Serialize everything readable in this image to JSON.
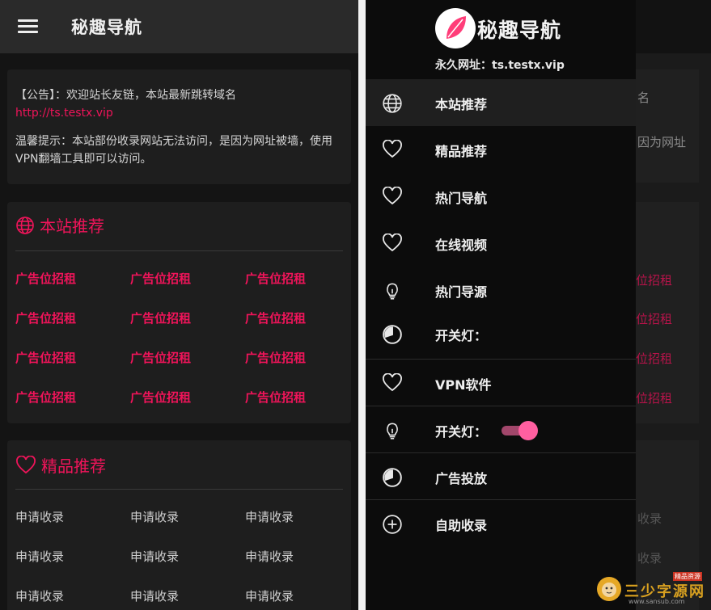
{
  "left": {
    "header": {
      "title": "秘趣导航"
    },
    "notice": {
      "line1": "【公告】：欢迎站长友链，本站最新跳转域名",
      "link": "http://ts.testx.vip",
      "tip": "温馨提示：本站部份收录网站无法访问，是因为网址被墙，使用VPN翻墙工具即可以访问。"
    },
    "section1": {
      "title": "本站推荐",
      "icon": "globe-icon",
      "items": [
        "广告位招租",
        "广告位招租",
        "广告位招租",
        "广告位招租",
        "广告位招租",
        "广告位招租",
        "广告位招租",
        "广告位招租",
        "广告位招租",
        "广告位招租",
        "广告位招租",
        "广告位招租"
      ]
    },
    "section2": {
      "title": "精品推荐",
      "icon": "heart-icon",
      "items": [
        "申请收录",
        "申请收录",
        "申请收录",
        "申请收录",
        "申请收录",
        "申请收录",
        "申请收录",
        "申请收录",
        "申请收录"
      ]
    }
  },
  "drawer": {
    "site_name": "秘趣导航",
    "permanent_url": "永久网址：ts.testx.vip",
    "menu": [
      {
        "label": "本站推荐",
        "icon": "globe-icon"
      },
      {
        "label": "精品推荐",
        "icon": "heart-icon"
      },
      {
        "label": "热门导航",
        "icon": "heart-icon"
      },
      {
        "label": "在线视频",
        "icon": "heart-icon"
      },
      {
        "label": "热门导源",
        "icon": "bulb-icon"
      },
      {
        "label": "开关灯：",
        "icon": "clock-icon"
      },
      {
        "label": "VPN软件",
        "icon": "heart-icon"
      },
      {
        "label": "开关灯：",
        "icon": "bulb-icon"
      },
      {
        "label": "广告投放",
        "icon": "clock-icon"
      },
      {
        "label": "自助收录",
        "icon": "plus-circle-icon"
      }
    ],
    "toggle_on": true
  },
  "background_ghost": {
    "items": [
      "名",
      "因为网址",
      "位招租",
      "位招租",
      "位招租",
      "位招租",
      "收录",
      "收录"
    ]
  },
  "watermark": {
    "text": "三少字源网",
    "badge": "精品资源",
    "sub": "www.sansub.com"
  },
  "colors": {
    "accent": "#f0145a",
    "toggle_knob": "#ff5fa0"
  }
}
